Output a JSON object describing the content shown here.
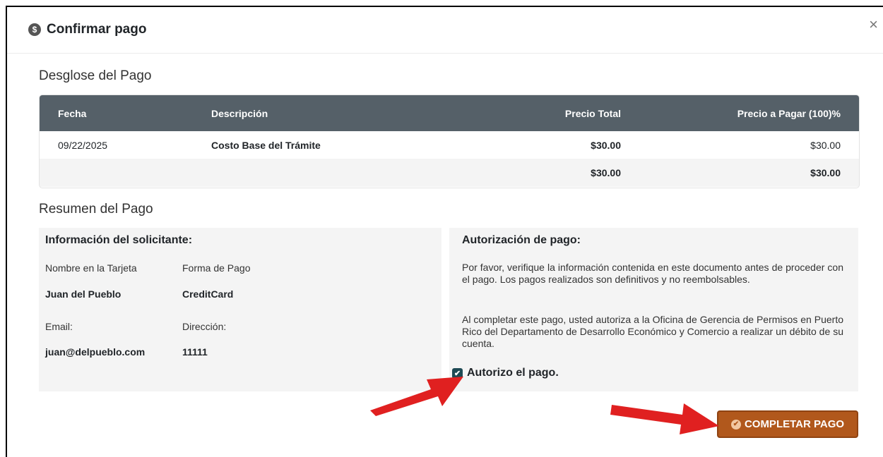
{
  "modal": {
    "title": "Confirmar pago",
    "close_symbol": "×"
  },
  "breakdown": {
    "title": "Desglose del Pago",
    "headers": [
      "Fecha",
      "Descripción",
      "Precio Total",
      "Precio a Pagar (100)%"
    ],
    "rows": [
      {
        "fecha": "09/22/2025",
        "descripcion": "Costo Base del Trámite",
        "precio_total": "$30.00",
        "precio_pagar": "$30.00"
      }
    ],
    "total": {
      "precio_total": "$30.00",
      "precio_pagar": "$30.00"
    }
  },
  "summary": {
    "title": "Resumen del Pago",
    "applicant": {
      "heading": "Información del solicitante:",
      "name_label": "Nombre en la Tarjeta",
      "name_value": "Juan del Pueblo",
      "payment_label": "Forma de Pago",
      "payment_value": "CreditCard",
      "email_label": "Email:",
      "email_value": "juan@delpueblo.com",
      "address_label": "Dirección:",
      "address_value": "11111"
    },
    "authorization": {
      "heading": "Autorización de pago:",
      "paragraph1": "Por favor, verifique la información contenida en este documento antes de proceder con el pago. Los pagos realizados son definitivos y no reembolsables.",
      "paragraph2": "Al completar este pago, usted autoriza a la Oficina de Gerencia de Permisos en Puerto Rico del Departamento de Desarrollo Económico y Comercio a realizar un débito de su cuenta.",
      "checkbox_label": "Autorizo el pago.",
      "checked": true
    }
  },
  "actions": {
    "complete_label": "COMPLETAR PAGO"
  },
  "colors": {
    "table_header": "#556068",
    "button": "#b1581c",
    "arrow": "#e02020"
  }
}
